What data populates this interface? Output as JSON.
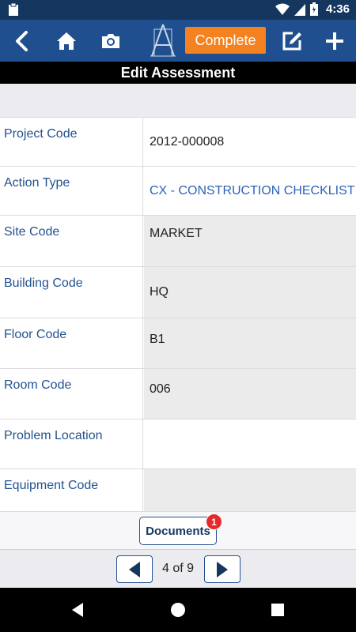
{
  "status_bar": {
    "time": "4:36",
    "icons": [
      "clipboard-icon",
      "wifi-icon",
      "signal-icon",
      "battery-icon"
    ]
  },
  "toolbar": {
    "icons": [
      "back-arrow-icon",
      "home-icon",
      "camera-icon",
      "app-logo",
      "edit-icon",
      "plus-icon"
    ],
    "complete_label": "Complete"
  },
  "title": "Edit Assessment",
  "fields": [
    {
      "label": "Project Code",
      "value": "2012-000008"
    },
    {
      "label": "Action Type",
      "value": "CX - CONSTRUCTION CHECKLIST"
    },
    {
      "label": "Site Code",
      "value": "MARKET"
    },
    {
      "label": "Building Code",
      "value": "HQ"
    },
    {
      "label": "Floor Code",
      "value": "B1"
    },
    {
      "label": "Room Code",
      "value": "006"
    },
    {
      "label": "Problem Location",
      "value": ""
    },
    {
      "label": "Equipment Code",
      "value": ""
    }
  ],
  "documents": {
    "label": "Documents",
    "badge": "1"
  },
  "pager": {
    "indicator": "4 of 9"
  },
  "colors": {
    "toolbar": "#1f4f8e",
    "status_bar": "#14365f",
    "accent": "#f58220",
    "label_text": "#24528f",
    "badge": "#e82929"
  }
}
